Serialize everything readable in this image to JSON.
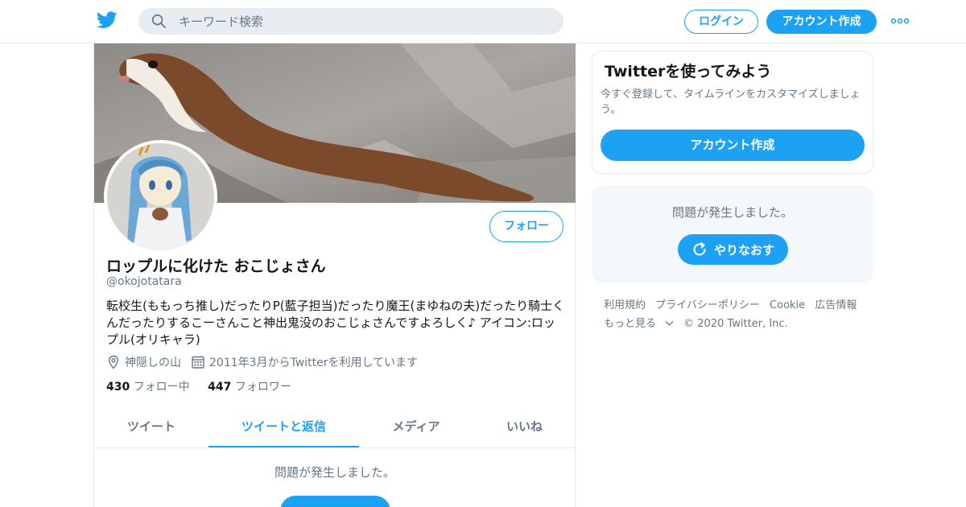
{
  "header": {
    "search_placeholder": "キーワード検索",
    "login_label": "ログイン",
    "signup_label": "アカウント作成"
  },
  "profile": {
    "display_name": "ロップルに化けた おこじょさん",
    "handle": "@okojotatara",
    "bio": "転校生(ももっち推し)だったりP(藍子担当)だったり魔王(まゆねの夫)だったり騎士くんだったりするこーさんこと神出鬼没のおこじょさんですよろしく♪ アイコン:ロップル(オリキャラ)",
    "location": "神隠しの山",
    "joined": "2011年3月からTwitterを利用しています",
    "following_count": "430",
    "following_label": "フォロー中",
    "followers_count": "447",
    "followers_label": "フォロワー",
    "follow_button": "フォロー"
  },
  "tabs": [
    {
      "label": "ツイート",
      "active": false
    },
    {
      "label": "ツイートと返信",
      "active": true
    },
    {
      "label": "メディア",
      "active": false
    },
    {
      "label": "いいね",
      "active": false
    }
  ],
  "timeline": {
    "error_text": "問題が発生しました。"
  },
  "signup_card": {
    "title": "Twitterを使ってみよう",
    "description": "今すぐ登録して、タイムラインをカスタマイズしましょう。",
    "button": "アカウント作成"
  },
  "sidebar_error": {
    "text": "問題が発生しました。",
    "retry_label": "やりなおす"
  },
  "footer": {
    "links": [
      "利用規約",
      "プライバシーポリシー",
      "Cookie",
      "広告情報",
      "もっと見る"
    ],
    "copyright": "© 2020 Twitter, Inc."
  },
  "colors": {
    "accent": "#1da1f2",
    "secondary_text": "#657786",
    "border": "#e6ecf0",
    "panel_bg": "#f5f8fa"
  },
  "icons": {
    "logo": "twitter-bird-icon",
    "search": "search-icon",
    "more": "more-dots-icon",
    "location": "location-pin-icon",
    "calendar": "calendar-icon",
    "retry": "refresh-icon",
    "chevron": "chevron-down-icon"
  }
}
